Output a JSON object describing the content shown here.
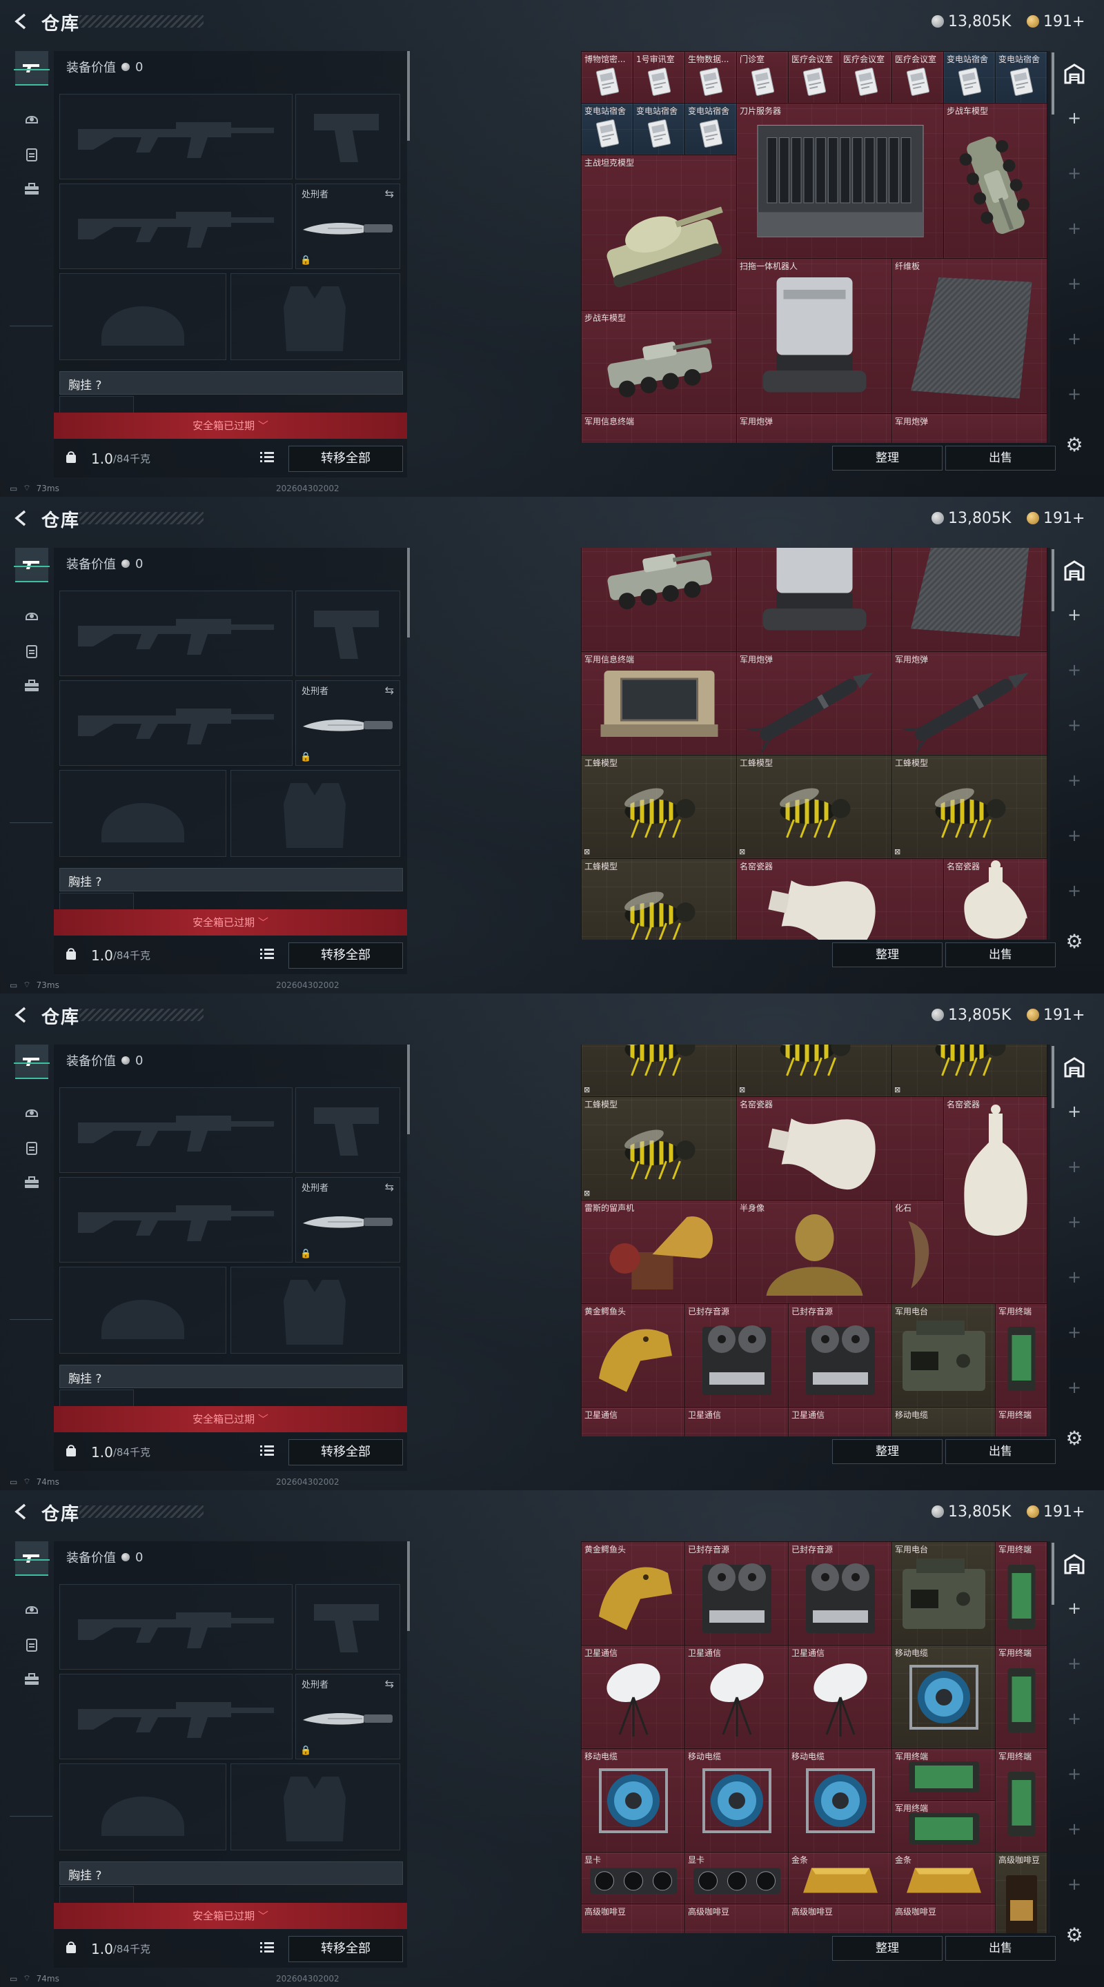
{
  "header": {
    "title": "仓库",
    "silver_coins": "13,805K",
    "gold_coins": "191+"
  },
  "sidebar_tabs": [
    {
      "name": "weapons-tab",
      "icon": "gun-icon",
      "active": true
    },
    {
      "name": "armor-tab",
      "icon": "helmet-icon",
      "active": false
    },
    {
      "name": "gear-tab",
      "icon": "vest-icon",
      "active": false
    },
    {
      "name": "case-tab",
      "icon": "briefcase-icon",
      "active": false
    }
  ],
  "equipment": {
    "value_label": "装备价值",
    "value": "0",
    "melee_label": "处刑者",
    "chest_label": "胸挂 ?",
    "safe_box_label": "安全箱已过期",
    "weight": "1.0",
    "weight_max": "/84千克",
    "transfer_all": "转移全部"
  },
  "actions": {
    "sort": "整理",
    "sell": "出售"
  },
  "status": [
    {
      "ping": "73ms",
      "build": "202604302002"
    },
    {
      "ping": "73ms",
      "build": "202604302002"
    },
    {
      "ping": "74ms",
      "build": "202604302002"
    },
    {
      "ping": "74ms",
      "build": "202604302002"
    }
  ],
  "storage_views": [
    [
      {
        "n": "博物馆密...",
        "c": 0,
        "r": 0,
        "w": 1,
        "h": 1,
        "t": "r",
        "i": "card"
      },
      {
        "n": "1号审讯室",
        "c": 1,
        "r": 0,
        "w": 1,
        "h": 1,
        "t": "r",
        "i": "card"
      },
      {
        "n": "生物数据...",
        "c": 2,
        "r": 0,
        "w": 1,
        "h": 1,
        "t": "r",
        "i": "card"
      },
      {
        "n": "门诊室",
        "c": 3,
        "r": 0,
        "w": 1,
        "h": 1,
        "t": "r",
        "i": "card"
      },
      {
        "n": "医疗会议室",
        "c": 4,
        "r": 0,
        "w": 1,
        "h": 1,
        "t": "r",
        "i": "card"
      },
      {
        "n": "医疗会议室",
        "c": 5,
        "r": 0,
        "w": 1,
        "h": 1,
        "t": "r",
        "i": "card"
      },
      {
        "n": "医疗会议室",
        "c": 6,
        "r": 0,
        "w": 1,
        "h": 1,
        "t": "r",
        "i": "card"
      },
      {
        "n": "变电站宿舍",
        "c": 7,
        "r": 0,
        "w": 1,
        "h": 1,
        "t": "b",
        "i": "card"
      },
      {
        "n": "变电站宿舍",
        "c": 8,
        "r": 0,
        "w": 1,
        "h": 1,
        "t": "b",
        "i": "card"
      },
      {
        "n": "变电站宿舍",
        "c": 0,
        "r": 1,
        "w": 1,
        "h": 1,
        "t": "b",
        "i": "card"
      },
      {
        "n": "变电站宿舍",
        "c": 1,
        "r": 1,
        "w": 1,
        "h": 1,
        "t": "b",
        "i": "card"
      },
      {
        "n": "变电站宿舍",
        "c": 2,
        "r": 1,
        "w": 1,
        "h": 1,
        "t": "b",
        "i": "card"
      },
      {
        "n": "刀片服务器",
        "c": 3,
        "r": 1,
        "w": 4,
        "h": 3,
        "t": "r",
        "i": "server"
      },
      {
        "n": "步战车模型",
        "c": 7,
        "r": 1,
        "w": 2,
        "h": 3,
        "t": "r",
        "i": "apc-v"
      },
      {
        "n": "主战坦克模型",
        "c": 0,
        "r": 2,
        "w": 3,
        "h": 3,
        "t": "r",
        "i": "tank"
      },
      {
        "n": "扫拖一体机器人",
        "c": 3,
        "r": 4,
        "w": 3,
        "h": 3,
        "t": "r",
        "i": "robot"
      },
      {
        "n": "纤维板",
        "c": 6,
        "r": 4,
        "w": 3,
        "h": 3,
        "t": "r",
        "i": "board"
      },
      {
        "n": "步战车模型",
        "c": 0,
        "r": 5,
        "w": 3,
        "h": 2,
        "t": "r",
        "i": "apc"
      },
      {
        "n": "军用信息终端",
        "c": 0,
        "r": 7,
        "w": 3,
        "h": 1,
        "t": "r",
        "i": ""
      },
      {
        "n": "军用炮弹",
        "c": 3,
        "r": 7,
        "w": 3,
        "h": 1,
        "t": "r",
        "i": ""
      },
      {
        "n": "军用炮弹",
        "c": 6,
        "r": 7,
        "w": 3,
        "h": 1,
        "t": "r",
        "i": ""
      }
    ],
    [
      {
        "n": "步战车模型",
        "c": 0,
        "r": -1,
        "w": 3,
        "h": 3,
        "t": "r",
        "i": "apc"
      },
      {
        "n": "",
        "c": 3,
        "r": -1,
        "w": 3,
        "h": 3,
        "t": "r",
        "i": "robot"
      },
      {
        "n": "",
        "c": 6,
        "r": -1,
        "w": 3,
        "h": 3,
        "t": "r",
        "i": "board"
      },
      {
        "n": "军用信息终端",
        "c": 0,
        "r": 2,
        "w": 3,
        "h": 2,
        "t": "r",
        "i": "case"
      },
      {
        "n": "军用炮弹",
        "c": 3,
        "r": 2,
        "w": 3,
        "h": 2,
        "t": "r",
        "i": "missile"
      },
      {
        "n": "军用炮弹",
        "c": 6,
        "r": 2,
        "w": 3,
        "h": 2,
        "t": "r",
        "i": "missile"
      },
      {
        "n": "工蜂模型",
        "c": 0,
        "r": 4,
        "w": 3,
        "h": 2,
        "t": "g",
        "i": "wasp",
        "tag": "⊠"
      },
      {
        "n": "工蜂模型",
        "c": 3,
        "r": 4,
        "w": 3,
        "h": 2,
        "t": "g",
        "i": "wasp",
        "tag": "⊠"
      },
      {
        "n": "工蜂模型",
        "c": 6,
        "r": 4,
        "w": 3,
        "h": 2,
        "t": "g",
        "i": "wasp",
        "tag": "⊠"
      },
      {
        "n": "工蜂模型",
        "c": 0,
        "r": 6,
        "w": 3,
        "h": 2,
        "t": "g",
        "i": "wasp"
      },
      {
        "n": "名窑瓷器",
        "c": 3,
        "r": 6,
        "w": 4,
        "h": 2,
        "t": "r",
        "i": "vase-h"
      },
      {
        "n": "名窑瓷器",
        "c": 7,
        "r": 6,
        "w": 2,
        "h": 2,
        "t": "r",
        "i": "vase"
      }
    ],
    [
      {
        "n": "",
        "c": 0,
        "r": -1,
        "w": 3,
        "h": 2,
        "t": "g",
        "i": "wasp",
        "tag": "⊠"
      },
      {
        "n": "",
        "c": 3,
        "r": -1,
        "w": 3,
        "h": 2,
        "t": "g",
        "i": "wasp",
        "tag": "⊠"
      },
      {
        "n": "",
        "c": 6,
        "r": -1,
        "w": 3,
        "h": 2,
        "t": "g",
        "i": "wasp",
        "tag": "⊠"
      },
      {
        "n": "工蜂模型",
        "c": 0,
        "r": 1,
        "w": 3,
        "h": 2,
        "t": "g",
        "i": "wasp",
        "tag": "⊠"
      },
      {
        "n": "名窑瓷器",
        "c": 3,
        "r": 1,
        "w": 4,
        "h": 2,
        "t": "r",
        "i": "vase-h"
      },
      {
        "n": "名窑瓷器",
        "c": 7,
        "r": 1,
        "w": 2,
        "h": 4,
        "t": "r",
        "i": "vase"
      },
      {
        "n": "雷斯的留声机",
        "c": 0,
        "r": 3,
        "w": 3,
        "h": 2,
        "t": "r",
        "i": "gramophone"
      },
      {
        "n": "半身像",
        "c": 3,
        "r": 3,
        "w": 3,
        "h": 2,
        "t": "r",
        "i": "bust"
      },
      {
        "n": "化石",
        "c": 6,
        "r": 3,
        "w": 1,
        "h": 2,
        "t": "r",
        "i": "fossil"
      },
      {
        "n": "黄金鳄鱼头",
        "c": 0,
        "r": 5,
        "w": 2,
        "h": 2,
        "t": "r",
        "i": "goldhead"
      },
      {
        "n": "已封存音源",
        "c": 2,
        "r": 5,
        "w": 2,
        "h": 2,
        "t": "r",
        "i": "reel"
      },
      {
        "n": "已封存音源",
        "c": 4,
        "r": 5,
        "w": 2,
        "h": 2,
        "t": "r",
        "i": "reel"
      },
      {
        "n": "军用电台",
        "c": 6,
        "r": 5,
        "w": 2,
        "h": 2,
        "t": "g",
        "i": "radio"
      },
      {
        "n": "军用终端",
        "c": 8,
        "r": 5,
        "w": 1,
        "h": 2,
        "t": "r",
        "i": "terminal"
      },
      {
        "n": "卫星通信",
        "c": 0,
        "r": 7,
        "w": 2,
        "h": 1,
        "t": "r",
        "i": ""
      },
      {
        "n": "卫星通信",
        "c": 2,
        "r": 7,
        "w": 2,
        "h": 1,
        "t": "r",
        "i": ""
      },
      {
        "n": "卫星通信",
        "c": 4,
        "r": 7,
        "w": 2,
        "h": 1,
        "t": "r",
        "i": ""
      },
      {
        "n": "移动电缆",
        "c": 6,
        "r": 7,
        "w": 2,
        "h": 1,
        "t": "g",
        "i": ""
      },
      {
        "n": "军用终端",
        "c": 8,
        "r": 7,
        "w": 1,
        "h": 1,
        "t": "r",
        "i": ""
      }
    ],
    [
      {
        "n": "黄金鳄鱼头",
        "c": 0,
        "r": 0,
        "w": 2,
        "h": 2,
        "t": "r",
        "i": "goldhead"
      },
      {
        "n": "已封存音源",
        "c": 2,
        "r": 0,
        "w": 2,
        "h": 2,
        "t": "r",
        "i": "reel"
      },
      {
        "n": "已封存音源",
        "c": 4,
        "r": 0,
        "w": 2,
        "h": 2,
        "t": "r",
        "i": "reel"
      },
      {
        "n": "军用电台",
        "c": 6,
        "r": 0,
        "w": 2,
        "h": 2,
        "t": "g",
        "i": "radio"
      },
      {
        "n": "军用终端",
        "c": 8,
        "r": 0,
        "w": 1,
        "h": 2,
        "t": "r",
        "i": "terminal"
      },
      {
        "n": "卫星通信",
        "c": 0,
        "r": 2,
        "w": 2,
        "h": 2,
        "t": "r",
        "i": "dish"
      },
      {
        "n": "卫星通信",
        "c": 2,
        "r": 2,
        "w": 2,
        "h": 2,
        "t": "r",
        "i": "dish"
      },
      {
        "n": "卫星通信",
        "c": 4,
        "r": 2,
        "w": 2,
        "h": 2,
        "t": "r",
        "i": "dish"
      },
      {
        "n": "移动电缆",
        "c": 6,
        "r": 2,
        "w": 2,
        "h": 2,
        "t": "g",
        "i": "cable"
      },
      {
        "n": "军用终端",
        "c": 8,
        "r": 2,
        "w": 1,
        "h": 2,
        "t": "r",
        "i": "terminal"
      },
      {
        "n": "移动电缆",
        "c": 0,
        "r": 4,
        "w": 2,
        "h": 2,
        "t": "r",
        "i": "cable"
      },
      {
        "n": "移动电缆",
        "c": 2,
        "r": 4,
        "w": 2,
        "h": 2,
        "t": "r",
        "i": "cable"
      },
      {
        "n": "移动电缆",
        "c": 4,
        "r": 4,
        "w": 2,
        "h": 2,
        "t": "r",
        "i": "cable"
      },
      {
        "n": "军用终端",
        "c": 6,
        "r": 4,
        "w": 2,
        "h": 1,
        "t": "r",
        "i": "terminal-h"
      },
      {
        "n": "军用终端",
        "c": 8,
        "r": 4,
        "w": 1,
        "h": 2,
        "t": "r",
        "i": "terminal"
      },
      {
        "n": "军用终端",
        "c": 6,
        "r": 5,
        "w": 2,
        "h": 1,
        "t": "r",
        "i": "terminal-h"
      },
      {
        "n": "显卡",
        "c": 0,
        "r": 6,
        "w": 2,
        "h": 1,
        "t": "r",
        "i": "gpu"
      },
      {
        "n": "显卡",
        "c": 2,
        "r": 6,
        "w": 2,
        "h": 1,
        "t": "r",
        "i": "gpu"
      },
      {
        "n": "金条",
        "c": 4,
        "r": 6,
        "w": 2,
        "h": 1,
        "t": "r",
        "i": "goldbar"
      },
      {
        "n": "金条",
        "c": 6,
        "r": 6,
        "w": 2,
        "h": 1,
        "t": "r",
        "i": "goldbar"
      },
      {
        "n": "高级咖啡豆",
        "c": 8,
        "r": 6,
        "w": 1,
        "h": 2,
        "t": "g",
        "i": "coffee"
      },
      {
        "n": "高级咖啡豆",
        "c": 0,
        "r": 7,
        "w": 2,
        "h": 1,
        "t": "r",
        "i": ""
      },
      {
        "n": "高级咖啡豆",
        "c": 2,
        "r": 7,
        "w": 2,
        "h": 1,
        "t": "r",
        "i": ""
      },
      {
        "n": "高级咖啡豆",
        "c": 4,
        "r": 7,
        "w": 2,
        "h": 1,
        "t": "r",
        "i": ""
      },
      {
        "n": "高级咖啡豆",
        "c": 6,
        "r": 7,
        "w": 2,
        "h": 1,
        "t": "r",
        "i": ""
      }
    ]
  ]
}
